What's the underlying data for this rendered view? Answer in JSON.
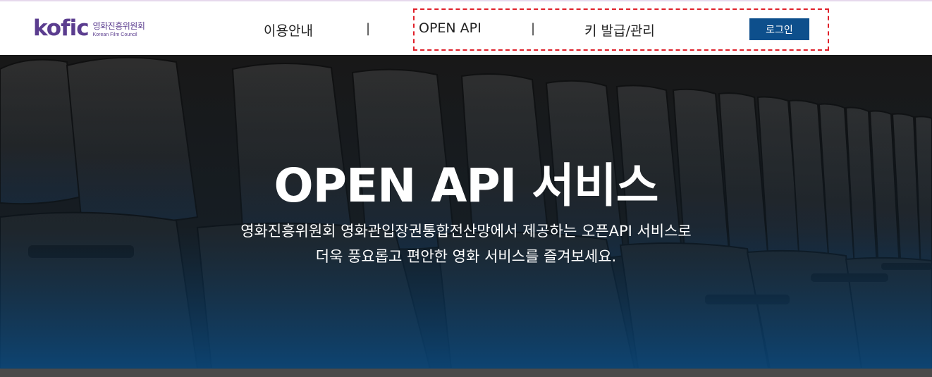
{
  "header": {
    "logo_mark": "kofic",
    "logo_korean": "영화진흥위원회",
    "logo_english": "Korean Film Council",
    "nav": [
      {
        "label": "이용안내"
      },
      {
        "label": "OPEN API"
      },
      {
        "label": "키 발급/관리"
      }
    ],
    "separator": "|",
    "login_label": "로그인"
  },
  "hero": {
    "title": "OPEN API 서비스",
    "subtitle_line1": "영화진흥위원회 영화관입장권통합전산망에서 제공하는 오픈API 서비스로",
    "subtitle_line2": "더욱 풍요롭고 편안한 영화 서비스를 즐겨보세요."
  },
  "colors": {
    "brand": "#5b3d8f",
    "login_button": "#0d4f8c",
    "highlight": "#e0202a"
  }
}
